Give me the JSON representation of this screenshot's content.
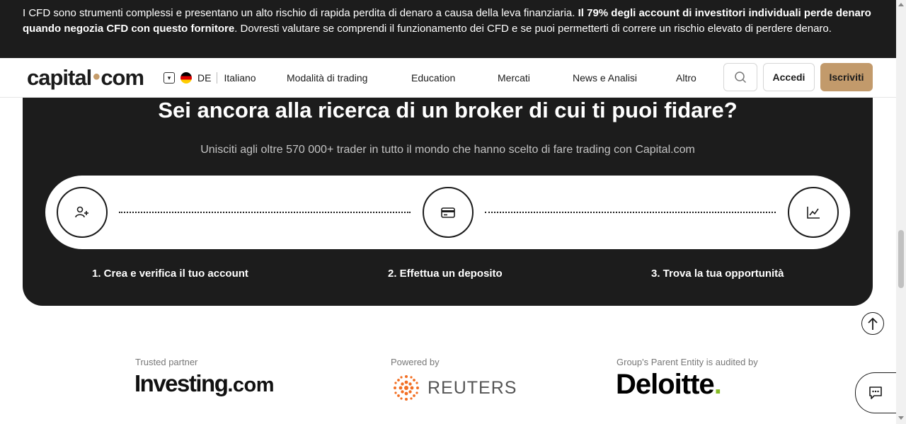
{
  "risk_banner": {
    "text_part1": "I CFD sono strumenti complessi e presentano un alto rischio di rapida perdita di denaro a causa della leva finanziaria. ",
    "text_bold": "Il 79% degli account di investitori individuali perde denaro quando negozia CFD con questo fornitore",
    "text_part2": ". Dovresti valutare se comprendi il funzionamento dei CFD e se puoi permetterti di correre un rischio elevato di perdere denaro."
  },
  "header": {
    "logo_left": "capital",
    "logo_right": "com",
    "country_code": "DE",
    "language": "Italiano",
    "nav": [
      "Modalità di trading",
      "Education",
      "Mercati",
      "News e Analisi",
      "Altro"
    ],
    "login_label": "Accedi",
    "signup_label": "Iscriviti"
  },
  "cta": {
    "title": "Sei ancora alla ricerca di un broker di cui ti puoi fidare?",
    "subtitle": "Unisciti agli oltre 570 000+ trader in tutto il mondo che hanno scelto di fare trading con Capital.com",
    "steps": [
      {
        "label": "1. Crea e verifica il tuo account",
        "icon": "add-user-icon"
      },
      {
        "label": "2. Effettua un deposito",
        "icon": "credit-card-icon"
      },
      {
        "label": "3. Trova la tua opportunità",
        "icon": "chart-line-icon"
      }
    ]
  },
  "partners": {
    "investing_caption": "Trusted partner",
    "investing_name": "Investing",
    "investing_suffix": ".com",
    "reuters_caption": "Powered by",
    "reuters_name": "REUTERS",
    "deloitte_caption": "Group's Parent Entity is audited by",
    "deloitte_name": "Deloitte",
    "deloitte_dot": "."
  },
  "colors": {
    "dark": "#1c1c1c",
    "accent": "#c29a6b",
    "deloitte_green": "#86bc25",
    "reuters_orange": "#f26e22"
  }
}
